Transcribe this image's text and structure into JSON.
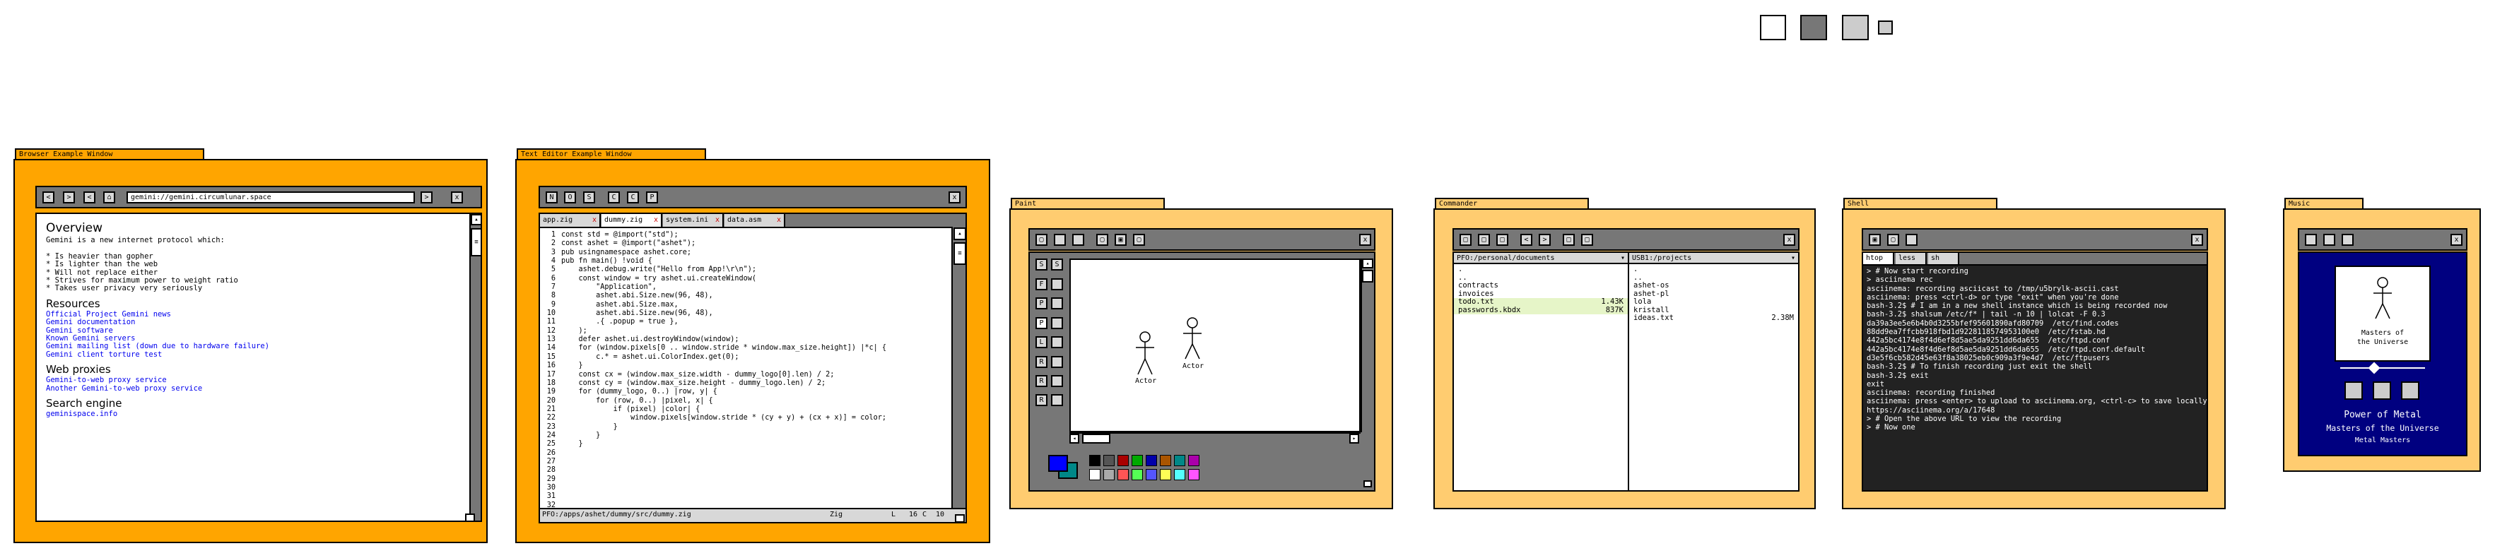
{
  "colors": {
    "window_orange": "#ffa500",
    "window_peach": "#ffcc70",
    "toolbar_gray": "#777777",
    "terminal_bg": "#222222",
    "music_blue": "#000080",
    "link_blue": "#0000ee",
    "highlight_green": "#e6f5c8"
  },
  "swatches": [
    {
      "name": "white",
      "color": "#ffffff"
    },
    {
      "name": "dark-gray",
      "color": "#777777"
    },
    {
      "name": "light-gray",
      "color": "#cccccc"
    },
    {
      "name": "small-light-gray",
      "color": "#cccccc"
    }
  ],
  "browser": {
    "title": "Browser Example Window",
    "nav_buttons": [
      "<",
      ">",
      "<",
      "⌂"
    ],
    "address": "gemini://gemini.circumlunar.space",
    "go_button": ">",
    "close_button": "x",
    "scroll_up": "▴",
    "scroll_down": "▾",
    "content": {
      "h_overview": "Overview",
      "intro": "Gemini is a new internet protocol which:",
      "bullets": [
        "* Is heavier than gopher",
        "* Is lighter than the web",
        "* Will not replace either",
        "* Strives for maximum power to weight ratio",
        "* Takes user privacy very seriously"
      ],
      "h_resources": "Resources",
      "resource_links": [
        "Official Project Gemini news",
        "Gemini documentation",
        "Gemini software",
        "Known Gemini servers",
        "Gemini mailing list (down due to hardware failure)",
        "Gemini client torture test"
      ],
      "h_proxies": "Web proxies",
      "proxy_links": [
        "Gemini-to-web proxy service",
        "Another Gemini-to-web proxy service"
      ],
      "h_search": "Search engine",
      "search_links": [
        "geminispace.info"
      ]
    }
  },
  "editor": {
    "title": "Text Editor Example Window",
    "toolbar_buttons": [
      "N",
      "O",
      "S",
      "C",
      "C",
      "P"
    ],
    "close_button": "x",
    "tabs": [
      {
        "label": "app.zig",
        "close": "x"
      },
      {
        "label": "dummy.zig",
        "close": "x"
      },
      {
        "label": "system.ini",
        "close": "x"
      },
      {
        "label": "data.asm",
        "close": "x"
      }
    ],
    "lines": [
      "const std = @import(\"std\");",
      "const ashet = @import(\"ashet\");",
      "",
      "pub usingnamespace ashet.core;",
      "",
      "pub fn main() !void {",
      "    ashet.debug.write(\"Hello from App!\\r\\n\");",
      "",
      "    const window = try ashet.ui.createWindow(",
      "        \"Application\",",
      "        ashet.abi.Size.new(96, 48),",
      "        ashet.abi.Size.max,",
      "        ashet.abi.Size.new(96, 48),",
      "        .{ .popup = true },",
      "    );",
      "    defer ashet.ui.destroyWindow(window);",
      "",
      "    for (window.pixels[0 .. window.stride * window.max_size.height]) |*c| {",
      "        c.* = ashet.ui.ColorIndex.get(0);",
      "    }",
      "",
      "    const cx = (window.max_size.width - dummy_logo[0].len) / 2;",
      "    const cy = (window.max_size.height - dummy_logo.len) / 2;",
      "",
      "    for (dummy_logo, 0..) |row, y| {",
      "        for (row, 0..) |pixel, x| {",
      "            if (pixel) |color| {",
      "                window.pixels[window.stride * (cy + y) + (cx + x)] = color;",
      "            }",
      "        }",
      "    }",
      ""
    ],
    "status_path": "PFO:/apps/ashet/dummy/src/dummy.zig",
    "status_lang": "Zig",
    "status_line_label": "L",
    "status_line": "16",
    "status_col_label": "C",
    "status_col": "10",
    "scroll_up": "▴",
    "scroll_down": "▾"
  },
  "paint": {
    "title": "Paint",
    "close_button": "x",
    "left_tools": [
      "S",
      "S",
      "F",
      "P",
      "P",
      "L",
      "R",
      "R",
      "R"
    ],
    "figure_labels": [
      "Actor",
      "Actor"
    ],
    "palette": [
      "#000000",
      "#555555",
      "#aa0000",
      "#00aa00",
      "#0000aa",
      "#aa5500",
      "#008888",
      "#aa00aa",
      "#ffffff",
      "#aaaaaa",
      "#ff5555",
      "#55ff55",
      "#5555ff",
      "#ffff55",
      "#55ffff",
      "#ff55ff"
    ],
    "fg_color": "#0000ff",
    "bg_color": "#008888"
  },
  "commander": {
    "title": "Commander",
    "close_button": "x",
    "toolbar_buttons": [
      "□",
      "□",
      "□",
      "<",
      ">",
      "□",
      "□"
    ],
    "left": {
      "path": "PFO:/personal/documents",
      "rows": [
        {
          "name": ".",
          "size": ""
        },
        {
          "name": "..",
          "size": ""
        },
        {
          "name": "contracts",
          "size": ""
        },
        {
          "name": "invoices",
          "size": ""
        },
        {
          "name": "todo.txt",
          "size": "1.43K"
        },
        {
          "name": "passwords.kbdx",
          "size": "837K"
        }
      ]
    },
    "right": {
      "path": "USB1:/projects",
      "rows": [
        {
          "name": ".",
          "size": ""
        },
        {
          "name": "..",
          "size": ""
        },
        {
          "name": "ashet-os",
          "size": ""
        },
        {
          "name": "ashet-pl",
          "size": ""
        },
        {
          "name": "lola",
          "size": ""
        },
        {
          "name": "kristall",
          "size": ""
        },
        {
          "name": "ideas.txt",
          "size": "2.38M"
        }
      ]
    }
  },
  "shell": {
    "title": "Shell",
    "close_button": "x",
    "tabs": [
      "htop",
      "less",
      "sh"
    ],
    "lines": [
      "> # Now start recording",
      "> asciinema rec",
      "asciinema: recording asciicast to /tmp/u5brylk-ascii.cast",
      "asciinema: press <ctrl-d> or type \"exit\" when you're done",
      "bash-3.2$ # I am in a new shell instance which is being recorded now",
      "bash-3.2$ shalsum /etc/f* | tail -n 10 | lolcat -F 0.3",
      "da39a3ee5e6b4b0d3255bfef95601890afd80709  /etc/find.codes",
      "88dd9ea7ffcbb918fbd1d9228118574953100e0  /etc/fstab.hd",
      "442a5bc4174e8f4d6ef8d5ae5da9251dd6da655  /etc/ftpd.conf",
      "442a5bc4174e8f4d6ef8d5ae5da9251dd6da655  /etc/ftpd.conf.default",
      "d3e5f6cb582d45e63f8a38025eb0c909a3f9e4d7  /etc/ftpusers",
      "bash-3.2$ # To finish recording just exit the shell",
      "bash-3.2$ exit",
      "exit",
      "asciinema: recording finished",
      "asciinema: press <enter> to upload to asciinema.org, <ctrl-c> to save locally",
      "",
      "https://asciinema.org/a/17648",
      "> # Open the above URL to view the recording",
      "> # Now one"
    ]
  },
  "music": {
    "title": "Music",
    "close_button": "x",
    "album_caption_1": "Masters of",
    "album_caption_2": "the Universe",
    "track_line_1": "Power of Metal",
    "track_line_2": "Masters of the Universe",
    "track_line_3": "Metal Masters",
    "progress": 0.4
  }
}
